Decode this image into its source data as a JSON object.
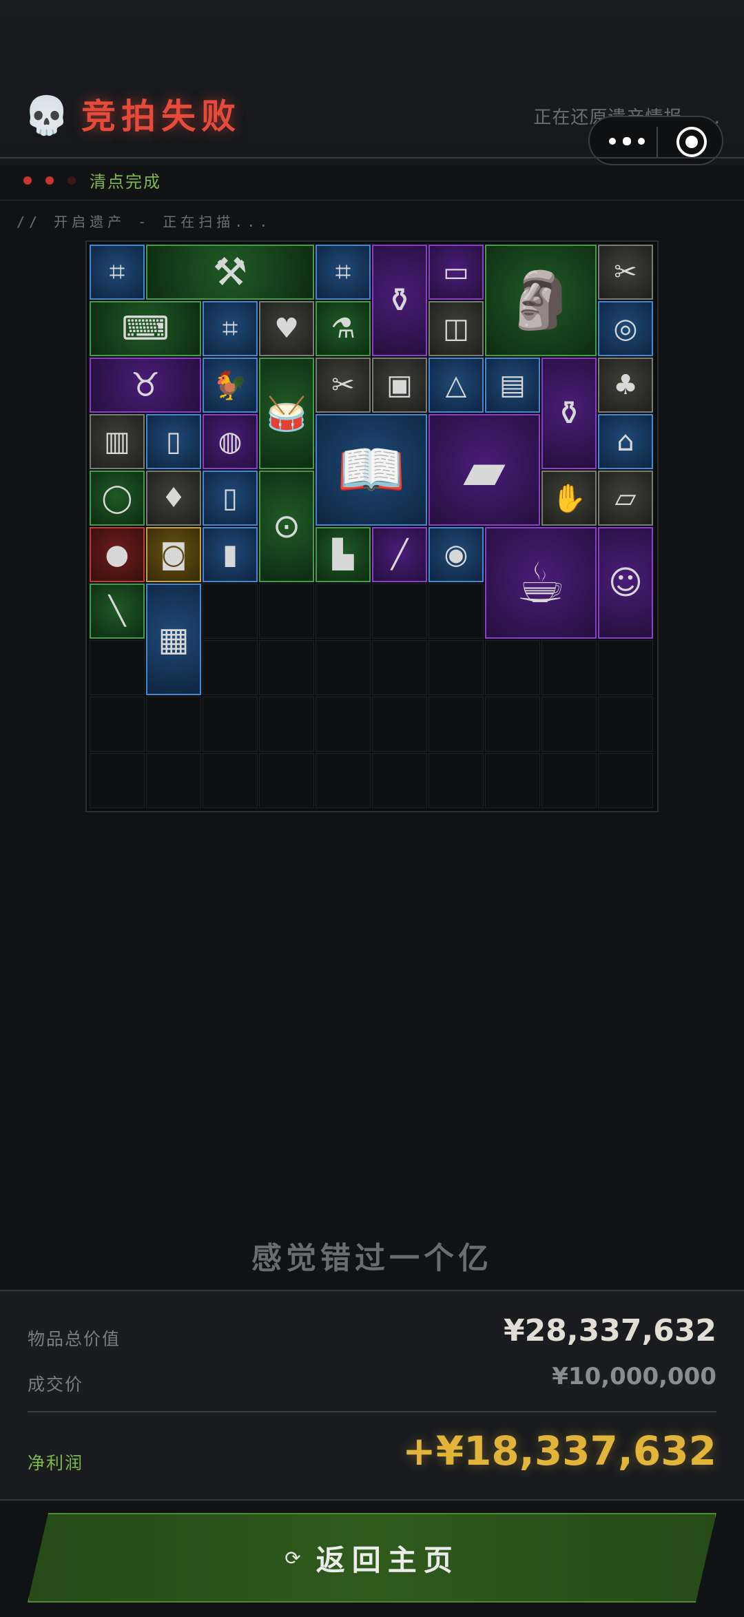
{
  "header": {
    "title": "竞拍失败",
    "restore_text": "正在还原遗产情报 . . .",
    "skull_icon": "💀"
  },
  "status": {
    "label": "清点完成",
    "dot_colors": [
      "#c8372d",
      "#c8372d",
      "#3a1a18"
    ]
  },
  "scan_text": "// 开启遗产 - 正在扫描...",
  "grid": {
    "columns": 10,
    "rows": 10,
    "items": [
      {
        "name": "usb-flash-drive",
        "rarity": "blue",
        "icon": "⌗",
        "col": 0,
        "row": 0,
        "w": 1,
        "h": 1
      },
      {
        "name": "sledgehammer",
        "rarity": "green",
        "icon": "⚒",
        "col": 1,
        "row": 0,
        "w": 3,
        "h": 1
      },
      {
        "name": "usb-flash-drive",
        "rarity": "blue",
        "icon": "⌗",
        "col": 4,
        "row": 0,
        "w": 1,
        "h": 1
      },
      {
        "name": "golden-ewer",
        "rarity": "purple",
        "icon": "⚱",
        "col": 5,
        "row": 0,
        "w": 1,
        "h": 2
      },
      {
        "name": "hard-drive",
        "rarity": "purple",
        "icon": "▭",
        "col": 6,
        "row": 0,
        "w": 1,
        "h": 1
      },
      {
        "name": "lamassu-statue",
        "rarity": "green",
        "icon": "🗿",
        "col": 7,
        "row": 0,
        "w": 2,
        "h": 2
      },
      {
        "name": "scissors",
        "rarity": "gray",
        "icon": "✂",
        "col": 9,
        "row": 0,
        "w": 1,
        "h": 1
      },
      {
        "name": "keyboard",
        "rarity": "green",
        "icon": "⌨",
        "col": 0,
        "row": 1,
        "w": 2,
        "h": 1
      },
      {
        "name": "usb-flash-drive",
        "rarity": "blue",
        "icon": "⌗",
        "col": 2,
        "row": 1,
        "w": 1,
        "h": 1
      },
      {
        "name": "playing-card",
        "rarity": "gray",
        "icon": "♥",
        "col": 3,
        "row": 1,
        "w": 1,
        "h": 1
      },
      {
        "name": "medicine-vial",
        "rarity": "green",
        "icon": "⚗",
        "col": 4,
        "row": 1,
        "w": 1,
        "h": 1
      },
      {
        "name": "paint-bucket",
        "rarity": "gray",
        "icon": "◫",
        "col": 6,
        "row": 1,
        "w": 1,
        "h": 1
      },
      {
        "name": "tin-can",
        "rarity": "blue",
        "icon": "◎",
        "col": 9,
        "row": 1,
        "w": 1,
        "h": 1
      },
      {
        "name": "horned-helmet",
        "rarity": "purple",
        "icon": "♉",
        "col": 0,
        "row": 2,
        "w": 2,
        "h": 1
      },
      {
        "name": "rooster-figurine",
        "rarity": "blue",
        "icon": "🐓",
        "col": 2,
        "row": 2,
        "w": 1,
        "h": 1
      },
      {
        "name": "djembe-drum",
        "rarity": "green",
        "icon": "🥁",
        "col": 3,
        "row": 2,
        "w": 1,
        "h": 2
      },
      {
        "name": "scissors",
        "rarity": "gray",
        "icon": "✂",
        "col": 4,
        "row": 2,
        "w": 1,
        "h": 1
      },
      {
        "name": "toolbox",
        "rarity": "gray",
        "icon": "▣",
        "col": 5,
        "row": 2,
        "w": 1,
        "h": 1
      },
      {
        "name": "triangle-token",
        "rarity": "blue",
        "icon": "△",
        "col": 6,
        "row": 2,
        "w": 1,
        "h": 1
      },
      {
        "name": "power-module",
        "rarity": "blue",
        "icon": "▤",
        "col": 7,
        "row": 2,
        "w": 1,
        "h": 1
      },
      {
        "name": "hookah",
        "rarity": "purple",
        "icon": "⚱",
        "col": 8,
        "row": 2,
        "w": 1,
        "h": 2
      },
      {
        "name": "playing-card",
        "rarity": "gray",
        "icon": "♣",
        "col": 9,
        "row": 2,
        "w": 1,
        "h": 1
      },
      {
        "name": "matchbox",
        "rarity": "gray",
        "icon": "▥",
        "col": 0,
        "row": 3,
        "w": 1,
        "h": 1
      },
      {
        "name": "cigarette-pack",
        "rarity": "blue",
        "icon": "▯",
        "col": 1,
        "row": 3,
        "w": 1,
        "h": 1
      },
      {
        "name": "food-bowl",
        "rarity": "purple",
        "icon": "◍",
        "col": 2,
        "row": 3,
        "w": 1,
        "h": 1
      },
      {
        "name": "fashion-magazine",
        "rarity": "blue",
        "icon": "📖",
        "col": 4,
        "row": 3,
        "w": 2,
        "h": 2
      },
      {
        "name": "laptop-case",
        "rarity": "purple",
        "icon": "▰",
        "col": 6,
        "row": 3,
        "w": 2,
        "h": 2
      },
      {
        "name": "water-bottle",
        "rarity": "blue",
        "icon": "⌂",
        "col": 9,
        "row": 3,
        "w": 1,
        "h": 1
      },
      {
        "name": "rope-coil",
        "rarity": "green",
        "icon": "◯",
        "col": 0,
        "row": 4,
        "w": 1,
        "h": 1
      },
      {
        "name": "playing-card",
        "rarity": "gray",
        "icon": "♦",
        "col": 1,
        "row": 4,
        "w": 1,
        "h": 1
      },
      {
        "name": "cigarette-pack",
        "rarity": "blue",
        "icon": "▯",
        "col": 2,
        "row": 4,
        "w": 1,
        "h": 1
      },
      {
        "name": "pressure-gauge",
        "rarity": "green",
        "icon": "⊙",
        "col": 3,
        "row": 4,
        "w": 1,
        "h": 2
      },
      {
        "name": "latex-glove",
        "rarity": "gray",
        "icon": "✋",
        "col": 8,
        "row": 4,
        "w": 1,
        "h": 1
      },
      {
        "name": "paper-note",
        "rarity": "gray",
        "icon": "▱",
        "col": 9,
        "row": 4,
        "w": 1,
        "h": 1
      },
      {
        "name": "glass-orb",
        "rarity": "red",
        "icon": "●",
        "col": 0,
        "row": 5,
        "w": 1,
        "h": 1
      },
      {
        "name": "camera",
        "rarity": "gold",
        "icon": "◙",
        "col": 1,
        "row": 5,
        "w": 1,
        "h": 1
      },
      {
        "name": "memory-card",
        "rarity": "blue",
        "icon": "▮",
        "col": 2,
        "row": 5,
        "w": 1,
        "h": 1
      },
      {
        "name": "lighter",
        "rarity": "green",
        "icon": "▙",
        "col": 4,
        "row": 5,
        "w": 1,
        "h": 1
      },
      {
        "name": "flute",
        "rarity": "purple",
        "icon": "╱",
        "col": 5,
        "row": 5,
        "w": 1,
        "h": 1
      },
      {
        "name": "compact-disc",
        "rarity": "blue",
        "icon": "◉",
        "col": 6,
        "row": 5,
        "w": 1,
        "h": 1
      },
      {
        "name": "coffee-machine",
        "rarity": "purple",
        "icon": "☕",
        "col": 7,
        "row": 5,
        "w": 2,
        "h": 2
      },
      {
        "name": "gingerbread-man",
        "rarity": "purple",
        "icon": "☺",
        "col": 9,
        "row": 5,
        "w": 1,
        "h": 2
      },
      {
        "name": "syringe",
        "rarity": "green",
        "icon": "╲",
        "col": 0,
        "row": 6,
        "w": 1,
        "h": 1
      },
      {
        "name": "ammo-box",
        "rarity": "blue",
        "icon": "▦",
        "col": 1,
        "row": 6,
        "w": 1,
        "h": 2
      }
    ]
  },
  "tagline": "感觉错过一个亿",
  "summary": {
    "total_label": "物品总价值",
    "total_value": "¥28,337,632",
    "deal_label": "成交价",
    "deal_value": "¥10,000,000",
    "net_label": "净利润",
    "net_value": "+¥18,337,632"
  },
  "home_button": {
    "label": "返回主页",
    "icon": "⟳"
  },
  "colors": {
    "title_red": "#e64a3b",
    "accent_green": "#7fb84a",
    "profit_gold": "#e3b43a"
  }
}
